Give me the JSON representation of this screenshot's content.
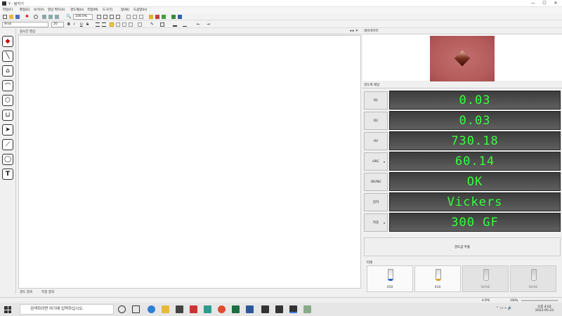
{
  "window": {
    "title": "Y - 탐지기",
    "min": "—",
    "max": "☐",
    "close": "✕"
  },
  "menu": [
    "파일(F)",
    "편집(E)",
    "보기(V)",
    "영상 획득(A)",
    "경도계(H)",
    "측정(M)",
    "도구(T)",
    "창(W)",
    "도움말(H)"
  ],
  "toolbar": {
    "zoom": "100.0%",
    "font": "Arial",
    "font_size": "20"
  },
  "palette": {
    "icons": [
      "diamond-tool-icon",
      "line-tool-icon",
      "home-tool-icon",
      "curve-tool-icon",
      "polygon-tool-icon",
      "basket-tool-icon",
      "pointer-tool-icon",
      "brush-tool-icon",
      "circle-tool-icon",
      "text-tool-icon"
    ]
  },
  "center": {
    "title": "실시간 영상",
    "tabs": [
      "경도 결과",
      "측정 결과"
    ]
  },
  "navigator": {
    "title": "네비게이터"
  },
  "measure": {
    "title": "경도계 패널",
    "rows": [
      {
        "label": "D1",
        "value": "0.03",
        "dropdown": false
      },
      {
        "label": "D2",
        "value": "0.03",
        "dropdown": false
      },
      {
        "label": "HV",
        "value": "730.18",
        "dropdown": false
      },
      {
        "label": "HRC",
        "value": "60.14",
        "dropdown": true
      },
      {
        "label": "OK/NG",
        "value": "OK",
        "dropdown": false
      },
      {
        "label": "압자",
        "value": "Vickers",
        "dropdown": false
      },
      {
        "label": "하중",
        "value": "300 GF",
        "dropdown": true
      }
    ],
    "calc_button": "경도값 추출"
  },
  "lens": {
    "title": "터렛",
    "items": [
      {
        "label": "X50",
        "active": true,
        "color": "#2060d0"
      },
      {
        "label": "X10",
        "active": true,
        "color": "#e0a020"
      },
      {
        "label": "NONE",
        "active": false,
        "color": "#999999"
      },
      {
        "label": "NONE",
        "active": false,
        "color": "#999999"
      }
    ]
  },
  "statusbar": {
    "fps": "0 FPS",
    "zoom": "100%"
  },
  "taskbar": {
    "search_placeholder": "검색하려면 여기에 입력하십시오.",
    "time": "오후 4:02",
    "date": "2022-05-23"
  },
  "colors": {
    "display_text": "#36ff3f",
    "display_bg": "#4a4a4a",
    "specimen": "#b45a5a"
  }
}
